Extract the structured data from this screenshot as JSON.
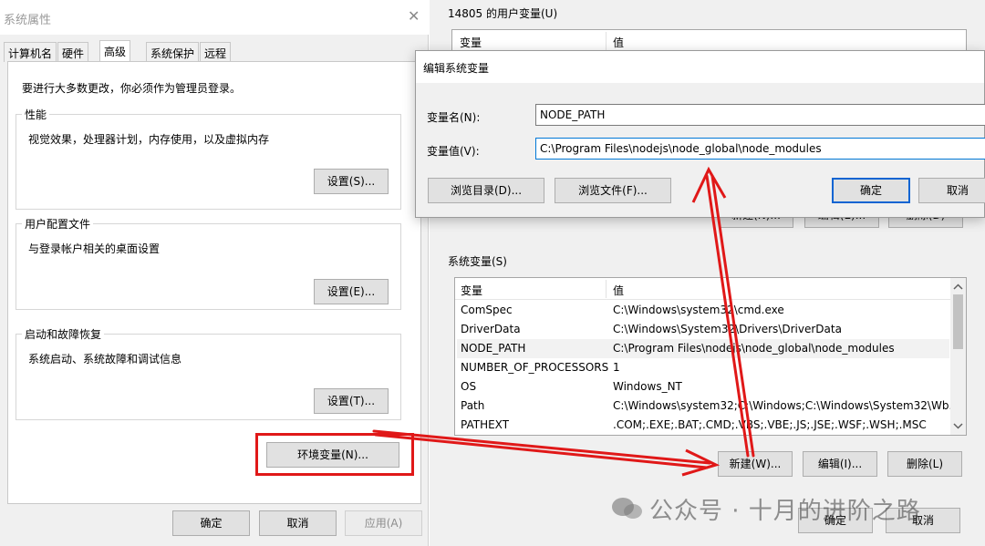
{
  "sysprops": {
    "title": "系统属性",
    "close_glyph": "✕",
    "tabs": [
      "计算机名",
      "硬件",
      "高级",
      "系统保护",
      "远程"
    ],
    "active_tab": "高级",
    "admin_note": "要进行大多数更改，你必须作为管理员登录。",
    "performance": {
      "legend": "性能",
      "desc": "视觉效果，处理器计划，内存使用，以及虚拟内存",
      "button": "设置(S)..."
    },
    "user_profiles": {
      "legend": "用户配置文件",
      "desc": "与登录帐户相关的桌面设置",
      "button": "设置(E)..."
    },
    "startup": {
      "legend": "启动和故障恢复",
      "desc": "系统启动、系统故障和调试信息",
      "button": "设置(T)..."
    },
    "env_button": "环境变量(N)...",
    "ok": "确定",
    "cancel": "取消",
    "apply": "应用(A)"
  },
  "envwin": {
    "user_vars_label": "14805 的用户变量(U)",
    "col_var": "变量",
    "col_val": "值",
    "user_buttons": {
      "new": "新建(N)...",
      "edit": "编辑(E)...",
      "delete": "删除(D)"
    },
    "sys_vars_label": "系统变量(S)",
    "sys_rows": [
      {
        "name": "ComSpec",
        "value": "C:\\Windows\\system32\\cmd.exe"
      },
      {
        "name": "DriverData",
        "value": "C:\\Windows\\System32\\Drivers\\DriverData"
      },
      {
        "name": "NODE_PATH",
        "value": "C:\\Program Files\\nodejs\\node_global\\node_modules"
      },
      {
        "name": "NUMBER_OF_PROCESSORS",
        "value": "1"
      },
      {
        "name": "OS",
        "value": "Windows_NT"
      },
      {
        "name": "Path",
        "value": "C:\\Windows\\system32;C:\\Windows;C:\\Windows\\System32\\Wb..."
      },
      {
        "name": "PATHEXT",
        "value": ".COM;.EXE;.BAT;.CMD;.VBS;.VBE;.JS;.JSE;.WSF;.WSH;.MSC"
      }
    ],
    "selected_row": "NODE_PATH",
    "sys_buttons": {
      "new": "新建(W)...",
      "edit": "编辑(I)...",
      "delete": "删除(L)"
    },
    "ok": "确定",
    "cancel": "取消"
  },
  "editdlg": {
    "title": "编辑系统变量",
    "name_label": "变量名(N):",
    "name_value": "NODE_PATH",
    "value_label": "变量值(V):",
    "value_value": "C:\\Program Files\\nodejs\\node_global\\node_modules",
    "browse_dir": "浏览目录(D)...",
    "browse_file": "浏览文件(F)...",
    "ok": "确定",
    "cancel": "取消"
  },
  "watermark": "公众号 · 十月的进阶之路",
  "colors": {
    "annotation_red": "#e01818",
    "focus_blue": "#0078d7",
    "dialog_bg": "#f0f0f0"
  },
  "icons": {
    "close": "close-icon",
    "scroll_up": "chevron-up-icon",
    "scroll_down": "chevron-down-icon",
    "watermark": "wechat-icon"
  }
}
